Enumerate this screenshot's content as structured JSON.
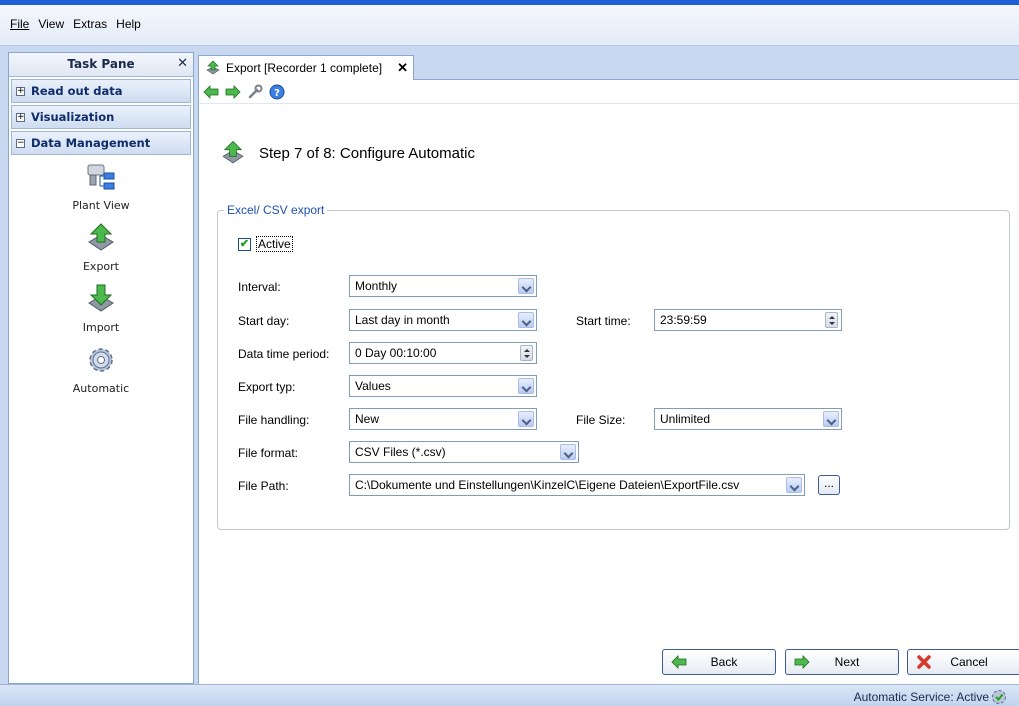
{
  "menu": {
    "file": "File",
    "view": "View",
    "extras": "Extras",
    "help": "Help"
  },
  "taskpane": {
    "title": "Task Pane",
    "close": "✕",
    "sections": [
      {
        "label": "Read out data",
        "toggle": "+"
      },
      {
        "label": "Visualization",
        "toggle": "+"
      },
      {
        "label": "Data Management",
        "toggle": "−"
      }
    ],
    "items": [
      {
        "label": "Plant View",
        "icon": "plant-view-icon"
      },
      {
        "label": "Export",
        "icon": "export-icon"
      },
      {
        "label": "Import",
        "icon": "import-icon"
      },
      {
        "label": "Automatic",
        "icon": "gear-icon"
      }
    ]
  },
  "tab": {
    "label": "Export [Recorder 1 complete]",
    "close": "✕"
  },
  "step": {
    "title": "Step 7 of 8: Configure Automatic"
  },
  "group": {
    "legend": "Excel/ CSV export",
    "active_label": "Active",
    "active_checked": true,
    "fields": {
      "interval": {
        "label": "Interval:",
        "value": "Monthly"
      },
      "start_day": {
        "label": "Start day:",
        "value": "Last day in month"
      },
      "start_time": {
        "label": "Start time:",
        "value": "23:59:59"
      },
      "data_time_period": {
        "label": "Data time period:",
        "value": "0 Day 00:10:00"
      },
      "export_typ": {
        "label": "Export typ:",
        "value": "Values"
      },
      "file_handling": {
        "label": "File handling:",
        "value": "New"
      },
      "file_size": {
        "label": "File Size:",
        "value": "Unlimited"
      },
      "file_format": {
        "label": "File format:",
        "value": "CSV Files (*.csv)"
      },
      "file_path": {
        "label": "File Path:",
        "value": "C:\\Dokumente und Einstellungen\\KinzelC\\Eigene Dateien\\ExportFile.csv"
      },
      "browse": "..."
    }
  },
  "buttons": {
    "back": "Back",
    "next": "Next",
    "cancel": "Cancel"
  },
  "status": {
    "text": "Automatic Service: Active"
  },
  "colors": {
    "accent": "#1f5fd6",
    "group_title": "#1f4fb5"
  }
}
